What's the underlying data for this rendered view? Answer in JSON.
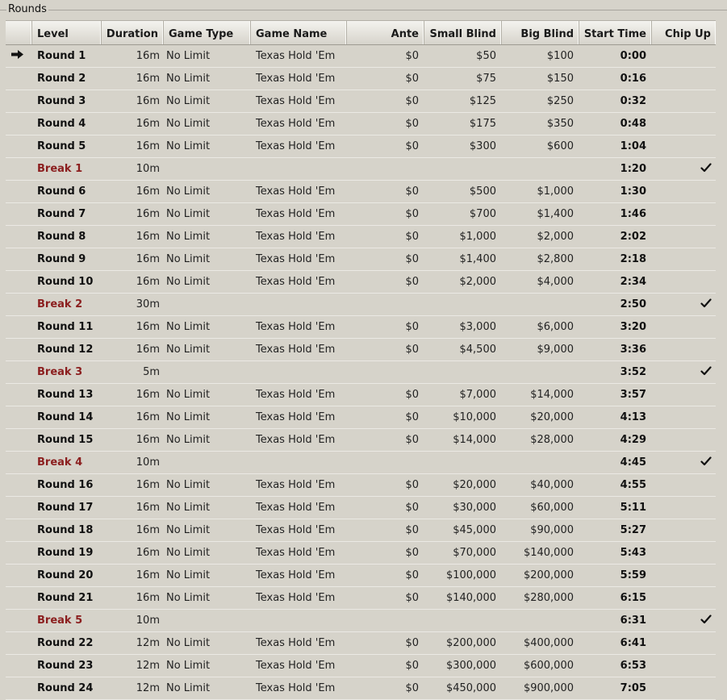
{
  "group": {
    "title": "Rounds"
  },
  "columns": [
    "Level",
    "Duration",
    "Game Type",
    "Game Name",
    "Ante",
    "Small Blind",
    "Big Blind",
    "Start Time",
    "Chip Up"
  ],
  "current_row": 0,
  "rows": [
    {
      "level": "Round 1",
      "type": "round",
      "duration": "16m",
      "game_type": "No Limit",
      "game_name": "Texas Hold 'Em",
      "ante": "$0",
      "small_blind": "$50",
      "big_blind": "$100",
      "start_time": "0:00",
      "chip_up": false
    },
    {
      "level": "Round 2",
      "type": "round",
      "duration": "16m",
      "game_type": "No Limit",
      "game_name": "Texas Hold 'Em",
      "ante": "$0",
      "small_blind": "$75",
      "big_blind": "$150",
      "start_time": "0:16",
      "chip_up": false
    },
    {
      "level": "Round 3",
      "type": "round",
      "duration": "16m",
      "game_type": "No Limit",
      "game_name": "Texas Hold 'Em",
      "ante": "$0",
      "small_blind": "$125",
      "big_blind": "$250",
      "start_time": "0:32",
      "chip_up": false
    },
    {
      "level": "Round 4",
      "type": "round",
      "duration": "16m",
      "game_type": "No Limit",
      "game_name": "Texas Hold 'Em",
      "ante": "$0",
      "small_blind": "$175",
      "big_blind": "$350",
      "start_time": "0:48",
      "chip_up": false
    },
    {
      "level": "Round 5",
      "type": "round",
      "duration": "16m",
      "game_type": "No Limit",
      "game_name": "Texas Hold 'Em",
      "ante": "$0",
      "small_blind": "$300",
      "big_blind": "$600",
      "start_time": "1:04",
      "chip_up": false
    },
    {
      "level": "Break 1",
      "type": "break",
      "duration": "10m",
      "game_type": "",
      "game_name": "",
      "ante": "",
      "small_blind": "",
      "big_blind": "",
      "start_time": "1:20",
      "chip_up": true
    },
    {
      "level": "Round 6",
      "type": "round",
      "duration": "16m",
      "game_type": "No Limit",
      "game_name": "Texas Hold 'Em",
      "ante": "$0",
      "small_blind": "$500",
      "big_blind": "$1,000",
      "start_time": "1:30",
      "chip_up": false
    },
    {
      "level": "Round 7",
      "type": "round",
      "duration": "16m",
      "game_type": "No Limit",
      "game_name": "Texas Hold 'Em",
      "ante": "$0",
      "small_blind": "$700",
      "big_blind": "$1,400",
      "start_time": "1:46",
      "chip_up": false
    },
    {
      "level": "Round 8",
      "type": "round",
      "duration": "16m",
      "game_type": "No Limit",
      "game_name": "Texas Hold 'Em",
      "ante": "$0",
      "small_blind": "$1,000",
      "big_blind": "$2,000",
      "start_time": "2:02",
      "chip_up": false
    },
    {
      "level": "Round 9",
      "type": "round",
      "duration": "16m",
      "game_type": "No Limit",
      "game_name": "Texas Hold 'Em",
      "ante": "$0",
      "small_blind": "$1,400",
      "big_blind": "$2,800",
      "start_time": "2:18",
      "chip_up": false
    },
    {
      "level": "Round 10",
      "type": "round",
      "duration": "16m",
      "game_type": "No Limit",
      "game_name": "Texas Hold 'Em",
      "ante": "$0",
      "small_blind": "$2,000",
      "big_blind": "$4,000",
      "start_time": "2:34",
      "chip_up": false
    },
    {
      "level": "Break 2",
      "type": "break",
      "duration": "30m",
      "game_type": "",
      "game_name": "",
      "ante": "",
      "small_blind": "",
      "big_blind": "",
      "start_time": "2:50",
      "chip_up": true
    },
    {
      "level": "Round 11",
      "type": "round",
      "duration": "16m",
      "game_type": "No Limit",
      "game_name": "Texas Hold 'Em",
      "ante": "$0",
      "small_blind": "$3,000",
      "big_blind": "$6,000",
      "start_time": "3:20",
      "chip_up": false
    },
    {
      "level": "Round 12",
      "type": "round",
      "duration": "16m",
      "game_type": "No Limit",
      "game_name": "Texas Hold 'Em",
      "ante": "$0",
      "small_blind": "$4,500",
      "big_blind": "$9,000",
      "start_time": "3:36",
      "chip_up": false
    },
    {
      "level": "Break 3",
      "type": "break",
      "duration": "5m",
      "game_type": "",
      "game_name": "",
      "ante": "",
      "small_blind": "",
      "big_blind": "",
      "start_time": "3:52",
      "chip_up": true
    },
    {
      "level": "Round 13",
      "type": "round",
      "duration": "16m",
      "game_type": "No Limit",
      "game_name": "Texas Hold 'Em",
      "ante": "$0",
      "small_blind": "$7,000",
      "big_blind": "$14,000",
      "start_time": "3:57",
      "chip_up": false
    },
    {
      "level": "Round 14",
      "type": "round",
      "duration": "16m",
      "game_type": "No Limit",
      "game_name": "Texas Hold 'Em",
      "ante": "$0",
      "small_blind": "$10,000",
      "big_blind": "$20,000",
      "start_time": "4:13",
      "chip_up": false
    },
    {
      "level": "Round 15",
      "type": "round",
      "duration": "16m",
      "game_type": "No Limit",
      "game_name": "Texas Hold 'Em",
      "ante": "$0",
      "small_blind": "$14,000",
      "big_blind": "$28,000",
      "start_time": "4:29",
      "chip_up": false
    },
    {
      "level": "Break 4",
      "type": "break",
      "duration": "10m",
      "game_type": "",
      "game_name": "",
      "ante": "",
      "small_blind": "",
      "big_blind": "",
      "start_time": "4:45",
      "chip_up": true
    },
    {
      "level": "Round 16",
      "type": "round",
      "duration": "16m",
      "game_type": "No Limit",
      "game_name": "Texas Hold 'Em",
      "ante": "$0",
      "small_blind": "$20,000",
      "big_blind": "$40,000",
      "start_time": "4:55",
      "chip_up": false
    },
    {
      "level": "Round 17",
      "type": "round",
      "duration": "16m",
      "game_type": "No Limit",
      "game_name": "Texas Hold 'Em",
      "ante": "$0",
      "small_blind": "$30,000",
      "big_blind": "$60,000",
      "start_time": "5:11",
      "chip_up": false
    },
    {
      "level": "Round 18",
      "type": "round",
      "duration": "16m",
      "game_type": "No Limit",
      "game_name": "Texas Hold 'Em",
      "ante": "$0",
      "small_blind": "$45,000",
      "big_blind": "$90,000",
      "start_time": "5:27",
      "chip_up": false
    },
    {
      "level": "Round 19",
      "type": "round",
      "duration": "16m",
      "game_type": "No Limit",
      "game_name": "Texas Hold 'Em",
      "ante": "$0",
      "small_blind": "$70,000",
      "big_blind": "$140,000",
      "start_time": "5:43",
      "chip_up": false
    },
    {
      "level": "Round 20",
      "type": "round",
      "duration": "16m",
      "game_type": "No Limit",
      "game_name": "Texas Hold 'Em",
      "ante": "$0",
      "small_blind": "$100,000",
      "big_blind": "$200,000",
      "start_time": "5:59",
      "chip_up": false
    },
    {
      "level": "Round 21",
      "type": "round",
      "duration": "16m",
      "game_type": "No Limit",
      "game_name": "Texas Hold 'Em",
      "ante": "$0",
      "small_blind": "$140,000",
      "big_blind": "$280,000",
      "start_time": "6:15",
      "chip_up": false
    },
    {
      "level": "Break 5",
      "type": "break",
      "duration": "10m",
      "game_type": "",
      "game_name": "",
      "ante": "",
      "small_blind": "",
      "big_blind": "",
      "start_time": "6:31",
      "chip_up": true
    },
    {
      "level": "Round 22",
      "type": "round",
      "duration": "12m",
      "game_type": "No Limit",
      "game_name": "Texas Hold 'Em",
      "ante": "$0",
      "small_blind": "$200,000",
      "big_blind": "$400,000",
      "start_time": "6:41",
      "chip_up": false
    },
    {
      "level": "Round 23",
      "type": "round",
      "duration": "12m",
      "game_type": "No Limit",
      "game_name": "Texas Hold 'Em",
      "ante": "$0",
      "small_blind": "$300,000",
      "big_blind": "$600,000",
      "start_time": "6:53",
      "chip_up": false
    },
    {
      "level": "Round 24",
      "type": "round",
      "duration": "12m",
      "game_type": "No Limit",
      "game_name": "Texas Hold 'Em",
      "ante": "$0",
      "small_blind": "$450,000",
      "big_blind": "$900,000",
      "start_time": "7:05",
      "chip_up": false
    }
  ],
  "icons": {
    "current": "arrow-right-icon",
    "chip_up": "checkmark-icon"
  },
  "colors": {
    "break_label": "#8b1e1e",
    "background": "#d6d3ca"
  }
}
